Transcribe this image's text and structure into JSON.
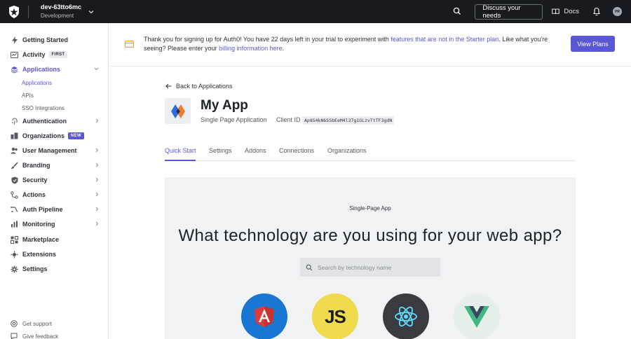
{
  "topbar": {
    "tenant_name": "dev-63tto6mc",
    "tenant_env": "Development",
    "discuss_label": "Discuss your needs",
    "docs_label": "Docs",
    "avatar_initials": "PR"
  },
  "sidebar": {
    "items": [
      {
        "label": "Getting Started",
        "icon": "bolt-icon"
      },
      {
        "label": "Activity",
        "icon": "activity-icon",
        "badge": "FIRST"
      },
      {
        "label": "Applications",
        "icon": "layers-icon"
      },
      {
        "label": "Authentication",
        "icon": "fingerprint-icon"
      },
      {
        "label": "Organizations",
        "icon": "building-icon",
        "badge": "NEW"
      },
      {
        "label": "User Management",
        "icon": "users-icon"
      },
      {
        "label": "Branding",
        "icon": "brush-icon"
      },
      {
        "label": "Security",
        "icon": "shield-icon"
      },
      {
        "label": "Actions",
        "icon": "actions-icon"
      },
      {
        "label": "Auth Pipeline",
        "icon": "pipeline-icon"
      },
      {
        "label": "Monitoring",
        "icon": "chart-icon"
      },
      {
        "label": "Marketplace",
        "icon": "marketplace-icon"
      },
      {
        "label": "Extensions",
        "icon": "puzzle-icon"
      },
      {
        "label": "Settings",
        "icon": "gear-icon"
      }
    ],
    "sub_items": [
      "Applications",
      "APIs",
      "SSO Integrations"
    ],
    "footer": [
      "Get support",
      "Give feedback"
    ]
  },
  "banner": {
    "text_1": "Thank you for signing up for Auth0! You have 22 days left in your trial to experiment with ",
    "link_1": "features that are not in the Starter plan",
    "text_2": ". Like what you're seeing? Please enter your ",
    "link_2": "billing information here",
    "text_3": ".",
    "button_label": "View Plans"
  },
  "app": {
    "back_label": "Back to Applications",
    "name": "My App",
    "type": "Single Page Application",
    "client_id_label": "Client ID",
    "client_id": "Ap8S4kN6SSbEeM4l37g1GLzvTtTF3gdN"
  },
  "tabs": [
    "Quick Start",
    "Settings",
    "Addons",
    "Connections",
    "Organizations"
  ],
  "quickstart": {
    "kicker": "Single-Page App",
    "title": "What technology are you using for your web app?",
    "search_placeholder": "Search by technology name",
    "technologies": [
      {
        "name": "Angular",
        "icon": "angular-icon",
        "color": "#1976d2"
      },
      {
        "name": "JavaScript",
        "icon": "js-icon",
        "label": "JS",
        "color": "#f0db4f"
      },
      {
        "name": "React",
        "icon": "react-icon",
        "color": "#3a3b40"
      },
      {
        "name": "Vue",
        "icon": "vue-icon",
        "color": "#e7efea"
      }
    ]
  },
  "colors": {
    "accent": "#5a57d6",
    "topbar": "#191a1f"
  }
}
